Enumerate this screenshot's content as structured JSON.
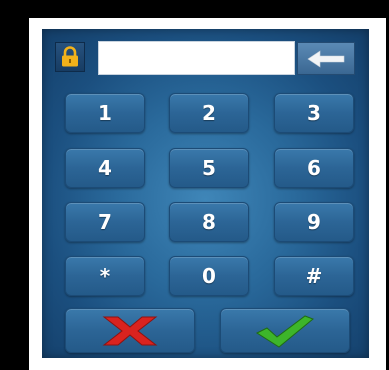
{
  "pin_entry": {
    "value": ""
  },
  "icons": {
    "lock": "padlock-icon",
    "backspace": "left-arrow-icon",
    "cancel": "red-x-icon",
    "confirm": "green-checkmark-icon"
  },
  "keypad": {
    "keys": [
      "1",
      "2",
      "3",
      "4",
      "5",
      "6",
      "7",
      "8",
      "9",
      "*",
      "0",
      "#"
    ]
  },
  "colors": {
    "panel": "#2a6a9c",
    "key": "#2c6596",
    "lock": "#f2b21a",
    "cancel": "#d9231f",
    "confirm": "#3db52a"
  }
}
